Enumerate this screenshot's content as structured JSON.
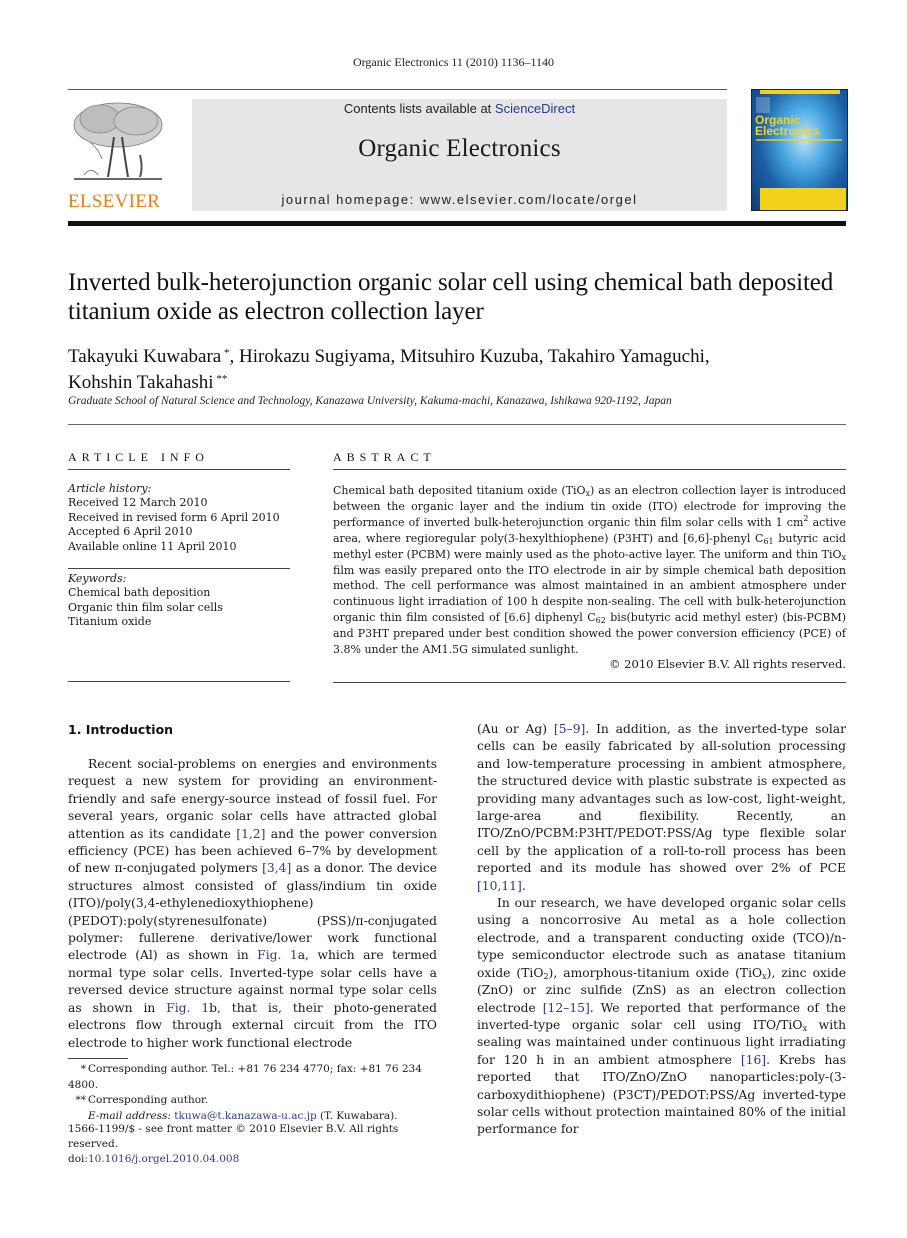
{
  "running_header": "Organic Electronics 11 (2010) 1136–1140",
  "masthead": {
    "publisher_logo_text": "ELSEVIER",
    "contents_prefix": "Contents lists available at ",
    "contents_link": "ScienceDirect",
    "journal_title": "Organic Electronics",
    "homepage_label": "journal homepage: www.elsevier.com/locate/orgel",
    "cover": {
      "title_line1": "Organic",
      "title_line2": "Electronics",
      "accent_color": "#f5d21e",
      "bg_color": "#1b5fa6"
    },
    "logo_color": "#f07c12",
    "link_color": "#2a3a8c"
  },
  "article": {
    "title": "Inverted bulk-heterojunction organic solar cell using chemical bath deposited titanium oxide as electron collection layer",
    "authors": [
      {
        "name": "Takayuki Kuwabara",
        "mark": "*",
        "sep": ", "
      },
      {
        "name": "Hirokazu Sugiyama",
        "mark": "",
        "sep": ", "
      },
      {
        "name": "Mitsuhiro Kuzuba",
        "mark": "",
        "sep": ", "
      },
      {
        "name": "Takahiro Yamaguchi",
        "mark": "",
        "sep": ","
      },
      {
        "name": "Kohshin Takahashi",
        "mark": "**",
        "sep": ""
      }
    ],
    "affiliation": "Graduate School of Natural Science and Technology, Kanazawa University, Kakuma-machi, Kanazawa, Ishikawa 920-1192, Japan"
  },
  "article_info": {
    "heading": "ARTICLE INFO",
    "history_label": "Article history:",
    "history": [
      "Received 12 March 2010",
      "Received in revised form 6 April 2010",
      "Accepted 6 April 2010",
      "Available online 11 April 2010"
    ],
    "keywords_label": "Keywords:",
    "keywords": [
      "Chemical bath deposition",
      "Organic thin film solar cells",
      "Titanium oxide"
    ]
  },
  "abstract": {
    "heading": "ABSTRACT",
    "segments": [
      {
        "t": "Chemical bath deposited titanium oxide (TiO"
      },
      {
        "sub": "x"
      },
      {
        "t": ") as an electron collection layer is introduced between the organic layer and the indium tin oxide (ITO) electrode for improving the performance of inverted bulk-heterojunction organic thin film solar cells with 1 cm"
      },
      {
        "sup": "2"
      },
      {
        "t": " active area, where regioregular poly(3-hexylthiophene) (P3HT) and [6,6]-phenyl C"
      },
      {
        "sub": "61"
      },
      {
        "t": " butyric acid methyl ester (PCBM) were mainly used as the photo-active layer. The uniform and thin TiO"
      },
      {
        "sub": "x"
      },
      {
        "t": " film was easily prepared onto the ITO electrode in air by simple chemical bath deposition method. The cell performance was almost maintained in an ambient atmosphere under continuous light irradiation of 100 h despite non-sealing. The cell with bulk-heterojunction organic thin film consisted of [6.6] diphenyl C"
      },
      {
        "sub": "62"
      },
      {
        "t": " bis(butyric acid methyl ester) (bis-PCBM) and P3HT prepared under best condition showed the power conversion efficiency (PCE) of 3.8% under the AM1.5G simulated sunlight."
      }
    ],
    "copyright": "© 2010 Elsevier B.V. All rights reserved."
  },
  "introduction": {
    "heading": "1. Introduction",
    "left_column": [
      {
        "indent": true,
        "segments": [
          {
            "t": "Recent social-problems on energies and environments request a new system for providing an environment-friendly and safe energy-source instead of fossil fuel. For several years, organic solar cells have attracted global attention as its candidate "
          },
          {
            "link": "[1,2]"
          },
          {
            "t": " and the power conversion efficiency (PCE) has been achieved 6–7% by development of new π-conjugated polymers "
          },
          {
            "link": "[3,4]"
          },
          {
            "t": " as a donor. The device structures almost consisted of glass/indium tin oxide (ITO)/poly(3,4-ethylenedioxythiophene) (PEDOT):poly(styrenesulfonate) (PSS)/π-conjugated polymer: fullerene derivative/lower work functional electrode (Al) as shown in "
          },
          {
            "link": "Fig. 1"
          },
          {
            "t": "a, which are termed normal type solar cells. Inverted-type solar cells have a reversed device structure against normal type solar cells as shown in "
          },
          {
            "link": "Fig. 1"
          },
          {
            "t": "b, that is, their photo-generated electrons flow through external circuit from the ITO electrode to higher work functional electrode"
          }
        ]
      }
    ],
    "right_column": [
      {
        "indent": false,
        "segments": [
          {
            "t": "(Au or Ag) "
          },
          {
            "link": "[5–9]"
          },
          {
            "t": ". In addition, as the inverted-type solar cells can be easily fabricated by all-solution processing and low-temperature processing in ambient atmosphere, the structured device with plastic substrate is expected as providing many advantages such as low-cost, light-weight, large-area and flexibility. Recently, an ITO/ZnO/PCBM:P3HT/PEDOT:PSS/Ag type flexible solar cell by the application of a roll-to-roll process has been reported and its module has showed over 2% of PCE "
          },
          {
            "link": "[10,11]"
          },
          {
            "t": "."
          }
        ]
      },
      {
        "indent": true,
        "segments": [
          {
            "t": "In our research, we have developed organic solar cells using a noncorrosive Au metal as a hole collection electrode, and a transparent conducting oxide (TCO)/n-type semiconductor electrode such as anatase titanium oxide (TiO"
          },
          {
            "sub": "2"
          },
          {
            "t": "), amorphous-titanium oxide (TiO"
          },
          {
            "sub": "x"
          },
          {
            "t": "), zinc oxide (ZnO) or zinc sulfide (ZnS) as an electron collection electrode "
          },
          {
            "link": "[12–15]"
          },
          {
            "t": ". We reported that performance of the inverted-type organic solar cell using ITO/TiO"
          },
          {
            "sub": "x"
          },
          {
            "t": " with sealing was maintained under continuous light irradiating for 120 h in an ambient atmosphere "
          },
          {
            "link": "[16]"
          },
          {
            "t": ". Krebs has reported that ITO/ZnO/ZnO nanoparticles:poly-(3-carboxydithiophene) (P3CT)/PEDOT:PSS/Ag inverted-type solar cells without protection maintained 80% of the initial performance for"
          }
        ]
      }
    ]
  },
  "footnotes": {
    "fn1_mark": "*",
    "fn1_text": "Corresponding author. Tel.: +81 76 234 4770; fax: +81 76 234 4800.",
    "fn2_mark": "**",
    "fn2_text": "Corresponding author.",
    "email_label": "E-mail address:",
    "email": "tkuwa@t.kanazawa-u.ac.jp",
    "email_suffix": " (T. Kuwabara).",
    "front_matter": "1566-1199/$ - see front matter © 2010 Elsevier B.V. All rights reserved.",
    "doi_prefix": "doi:",
    "doi": "10.1016/j.orgel.2010.04.008"
  }
}
